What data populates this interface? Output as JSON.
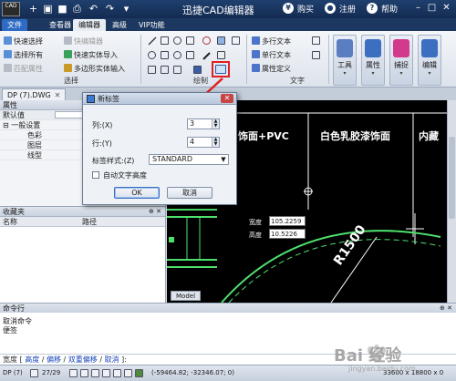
{
  "window": {
    "title": "迅捷CAD编辑器",
    "logo_text": "CAD",
    "buy_label": "购买",
    "register_label": "注册",
    "help_label": "帮助"
  },
  "menu_tabs": [
    "文件",
    "查看器",
    "编辑器",
    "高级",
    "VIP功能"
  ],
  "ribbon": {
    "select_group": {
      "label": "选择",
      "quick_select": "快速选择",
      "select_all": "选择所有",
      "match_props": "匹配属性",
      "quick_block": "快编辑器",
      "quick_entity_import": "快速实体导入",
      "polygon_entity_input": "多边形实体输入"
    },
    "draw_group": {
      "label": "绘制"
    },
    "text_group": {
      "label": "文字",
      "multiline_text": "多行文本",
      "single_text": "单行文本",
      "attr_def": "属性定义"
    },
    "big_buttons": [
      "工具",
      "属性",
      "捕捉",
      "编辑"
    ]
  },
  "document_tab": {
    "label": "DP (7).DWG"
  },
  "properties_panel": {
    "title": "属性",
    "default_label": "默认值",
    "section": "一般设置",
    "rows": [
      "色彩",
      "图层",
      "线型"
    ]
  },
  "favorites_panel": {
    "title": "收藏夹",
    "columns": [
      "名称",
      "路径"
    ]
  },
  "dialog": {
    "title": "新标签",
    "columns_label": "列:(X)",
    "columns_value": "3",
    "rows_label": "行:(Y)",
    "rows_value": "4",
    "style_label": "标签样式:(Z)",
    "style_value": "STANDARD",
    "auto_text_height": "自动文字高度",
    "ok": "OK",
    "cancel": "取消"
  },
  "canvas": {
    "text_left": "饰面+PVC",
    "text_mid": "白色乳胶漆饰面",
    "text_right": "内藏",
    "dim_width_label": "宽度",
    "dim_width_value": "105.2259",
    "dim_height_label": "高度",
    "dim_height_value": "10.5226",
    "radius_label": "R1500",
    "model_tab": "Model"
  },
  "command": {
    "title": "命令行",
    "lines": [
      "取消命令",
      "便签"
    ],
    "prompt_head": "宽度 [",
    "options": [
      "高度",
      "偏移",
      "双重偏移",
      "取消"
    ],
    "prompt_tail": "]:"
  },
  "status": {
    "file": "DP (7)",
    "pages": "27/29",
    "coords": "(-59464.82; -32346.07; 0)",
    "size": "33600 x 18800 x 0"
  },
  "watermark": {
    "text": "Bai 经验",
    "sub": "jingyan.baidu.com"
  },
  "colors": {
    "title_bar": "#1f3f6e",
    "canvas_bg": "#000000",
    "cad_line": "#4fe06c",
    "highlight_red": "#e02020"
  }
}
